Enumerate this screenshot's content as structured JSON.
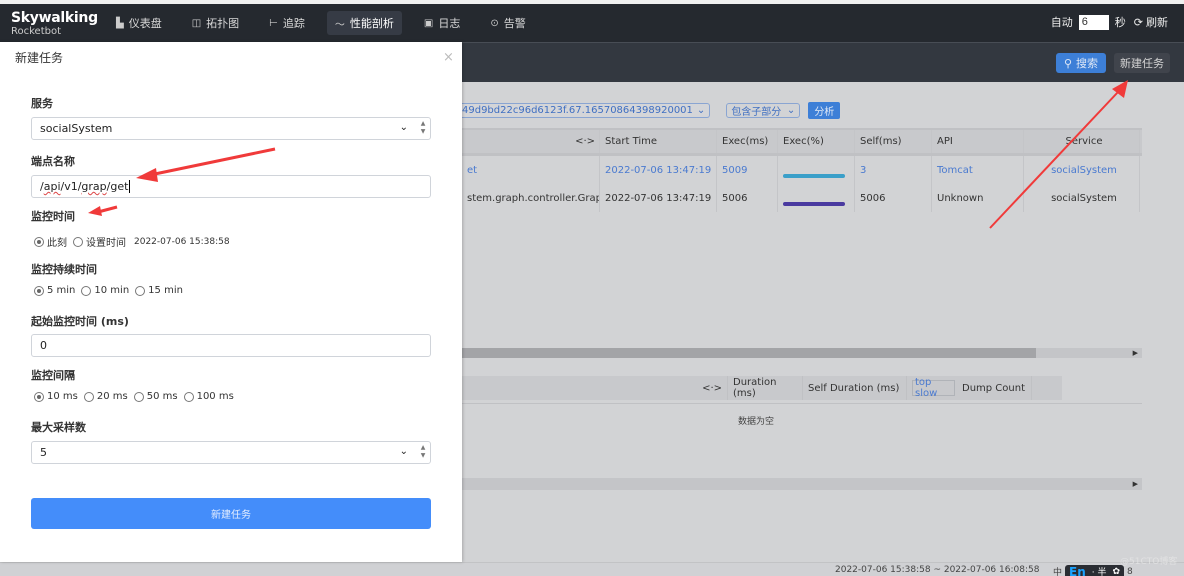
{
  "app": {
    "logo_line1": "Skywalking",
    "logo_line2": "Rocketbot"
  },
  "nav": {
    "items": [
      {
        "label": "仪表盘",
        "icon": "dashboard-icon",
        "glyph": "▙",
        "active": false
      },
      {
        "label": "拓扑图",
        "icon": "topology-icon",
        "glyph": "◫",
        "active": false
      },
      {
        "label": "追踪",
        "icon": "trace-icon",
        "glyph": "⊢",
        "active": false
      },
      {
        "label": "性能剖析",
        "icon": "profile-icon",
        "glyph": "〜",
        "active": true
      },
      {
        "label": "日志",
        "icon": "log-icon",
        "glyph": "▣",
        "active": false
      },
      {
        "label": "告警",
        "icon": "alarm-icon",
        "glyph": "⊙",
        "active": false
      }
    ],
    "auto_label": "自动",
    "auto_value": "6",
    "seconds_label": "秒",
    "refresh_label": "刷新"
  },
  "subbar": {
    "search_label": "搜索",
    "new_task_label": "新建任务"
  },
  "analysis": {
    "trace_select": "49d9bd22c96d6123f.67.16570864398920001",
    "mode_select": "包含子部分",
    "analyze_label": "分析"
  },
  "span_table": {
    "columns": [
      "<·>",
      "Start Time",
      "Exec(ms)",
      "Exec(%)",
      "Self(ms)",
      "API",
      "Service"
    ],
    "rows": [
      {
        "method": "et",
        "start": "2022-07-06 13:47:19",
        "exec_ms": "5009",
        "exec_pct": 100,
        "self_ms": "3",
        "api": "Tomcat",
        "service": "socialSystem",
        "highlight": true,
        "bar_color": "#3a9fc9"
      },
      {
        "method": "stem.graph.controller.Graph...",
        "start": "2022-07-06 13:47:19",
        "exec_ms": "5006",
        "exec_pct": 100,
        "self_ms": "5006",
        "api": "Unknown",
        "service": "socialSystem",
        "highlight": false,
        "bar_color": "#4a3aa0"
      }
    ]
  },
  "thread_table": {
    "columns": [
      "<·>",
      "Duration (ms)",
      "Self Duration (ms)",
      "top slow",
      "Dump Count"
    ],
    "empty_text": "数据为空"
  },
  "footer": {
    "time_range": "2022-07-06 15:38:58 ~ 2022-07-06 16:08:58",
    "ime_cn": "中",
    "ime_en": "En",
    "ime_extra": "· 半",
    "ime_num": "8",
    "watermark": "@51CTO博客"
  },
  "modal": {
    "title": "新建任务",
    "close": "×",
    "service_label": "服务",
    "service_value": "socialSystem",
    "endpoint_label": "端点名称",
    "endpoint_parts": [
      "/",
      "api",
      "/v1/",
      "grap",
      "/get"
    ],
    "monitor_time_label": "监控时间",
    "monitor_time_options": [
      {
        "label": "此刻",
        "checked": true
      },
      {
        "label": "设置时间",
        "checked": false
      }
    ],
    "monitor_time_value": "2022-07-06 15:38:58",
    "duration_label": "监控持续时间",
    "duration_options": [
      {
        "label": "5 min",
        "checked": true
      },
      {
        "label": "10 min",
        "checked": false
      },
      {
        "label": "15 min",
        "checked": false
      }
    ],
    "start_label": "起始监控时间 (ms)",
    "start_value": "0",
    "interval_label": "监控间隔",
    "interval_options": [
      {
        "label": "10 ms",
        "checked": true
      },
      {
        "label": "20 ms",
        "checked": false
      },
      {
        "label": "50 ms",
        "checked": false
      },
      {
        "label": "100 ms",
        "checked": false
      }
    ],
    "max_sample_label": "最大采样数",
    "max_sample_value": "5",
    "submit_label": "新建任务"
  },
  "colors": {
    "topbar": "#25292f",
    "accent": "#448dfa",
    "annotation": "#f03a3a"
  }
}
